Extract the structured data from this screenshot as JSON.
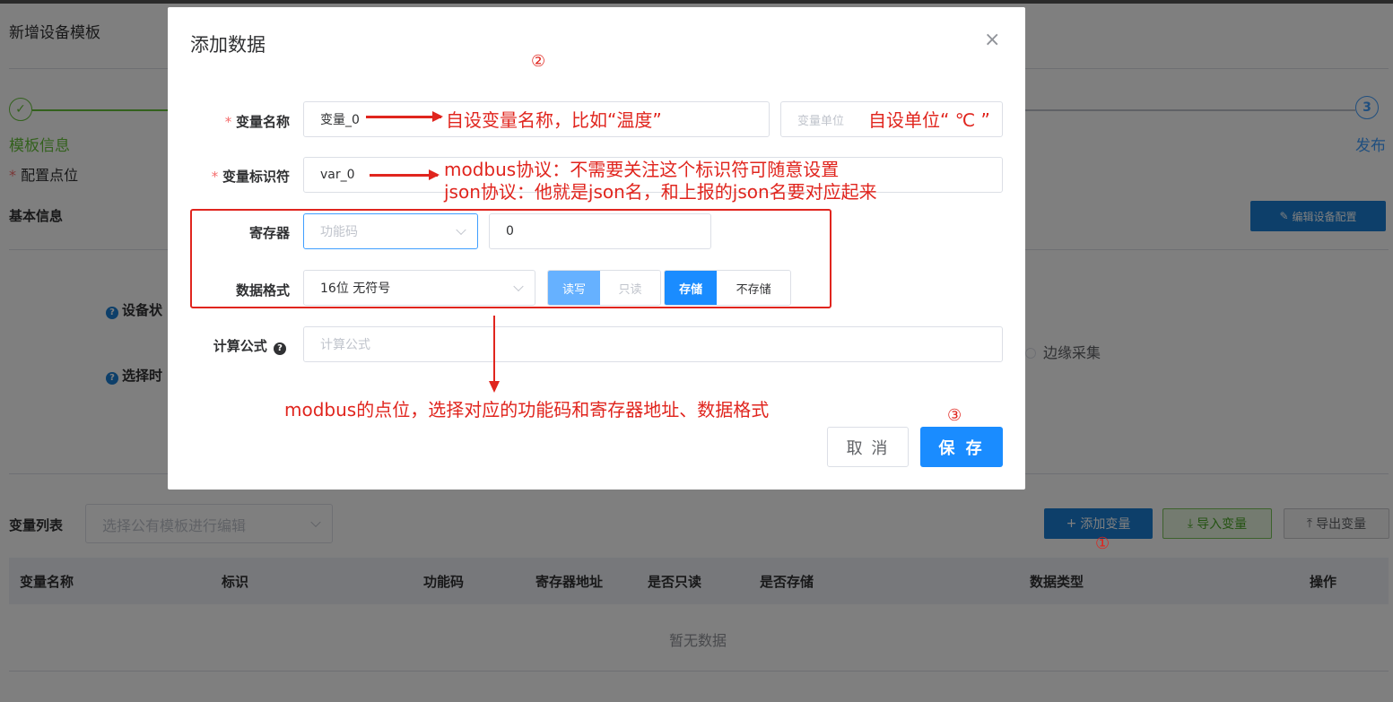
{
  "page": {
    "title": "新增设备模板",
    "steps": [
      {
        "icon": "check",
        "label": "模板信息"
      },
      {
        "number": "3",
        "label": "发布"
      }
    ],
    "config_points": "配置点位",
    "basic_info": "基本信息",
    "edit_config_button": "编辑设备配置",
    "device_label": "设备状",
    "select_label": "选择时",
    "edge_collect": "边缘采集",
    "var_list_title": "变量列表",
    "template_select_placeholder": "选择公有模板进行编辑",
    "add_var_button": "添加变量",
    "import_var_button": "导入变量",
    "export_var_button": "导出变量",
    "table_headers": [
      "变量名称",
      "标识",
      "功能码",
      "寄存器地址",
      "是否只读",
      "是否存储",
      "数据类型",
      "操作"
    ],
    "empty_text": "暂无数据"
  },
  "dialog": {
    "title": "添加数据",
    "close_glyph": "×",
    "var_name_label": "变量名称",
    "var_name_value": "变量_0",
    "unit_placeholder": "变量单位",
    "var_id_label": "变量标识符",
    "var_id_value": "var_0",
    "register_label": "寄存器",
    "func_code_placeholder": "功能码",
    "register_address": "0",
    "data_format_label": "数据格式",
    "data_format_value": "16位 无符号",
    "rw_options": [
      "读写",
      "只读"
    ],
    "store_options": [
      "存储",
      "不存储"
    ],
    "formula_label": "计算公式",
    "formula_placeholder": "计算公式",
    "cancel_button": "取 消",
    "save_button": "保 存"
  },
  "annotations": {
    "name_note": "自设变量名称，比如“温度”",
    "unit_note": "自设单位“ ℃ ”",
    "id_note_line1": "modbus协议：不需要关注这个标识符可随意设置",
    "id_note_line2": "json协议：他就是json名，和上报的json名要对应起来",
    "register_note": "modbus的点位，选择对应的功能码和寄存器地址、数据格式",
    "mark_1": "①",
    "mark_2": "②",
    "mark_3": "③"
  },
  "colors": {
    "primary": "#1a8cff",
    "success": "#67c23a",
    "annotation_red": "#e0251e"
  }
}
